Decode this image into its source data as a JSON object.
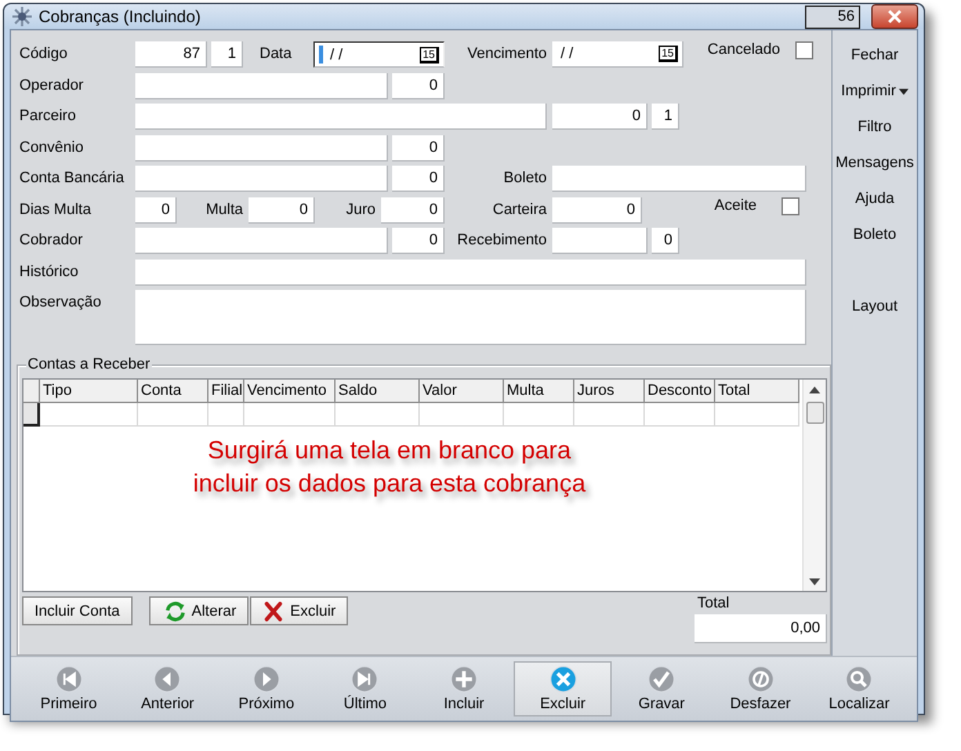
{
  "window": {
    "title": "Cobranças (Incluindo)",
    "counter": "56"
  },
  "form": {
    "codigo": {
      "label": "Código",
      "value": "87",
      "seq": "1"
    },
    "data": {
      "label": "Data",
      "value": "/ /",
      "calendar": "15",
      "focused": true
    },
    "vencimento": {
      "label": "Vencimento",
      "value": "/ /",
      "calendar": "15",
      "focused": false
    },
    "cancelado": {
      "label": "Cancelado",
      "checked": false
    },
    "operador": {
      "label": "Operador",
      "value": "0"
    },
    "parceiro": {
      "label": "Parceiro",
      "value": "0",
      "seq": "1"
    },
    "convenio": {
      "label": "Convênio",
      "value": "0"
    },
    "conta_bancaria": {
      "label": "Conta Bancária",
      "value": "0"
    },
    "boleto": {
      "label": "Boleto"
    },
    "dias_multa": {
      "label": "Dias Multa",
      "value": "0"
    },
    "multa": {
      "label": "Multa",
      "value": "0"
    },
    "juro": {
      "label": "Juro",
      "value": "0"
    },
    "carteira": {
      "label": "Carteira",
      "value": "0"
    },
    "aceite": {
      "label": "Aceite",
      "checked": false
    },
    "cobrador": {
      "label": "Cobrador",
      "value": "0"
    },
    "recebimento": {
      "label": "Recebimento",
      "value": "0"
    },
    "historico": {
      "label": "Histórico"
    },
    "observacao": {
      "label": "Observação"
    }
  },
  "sidebar": [
    {
      "label": "Fechar",
      "dropdown": false
    },
    {
      "label": "Imprimir",
      "dropdown": true
    },
    {
      "label": "Filtro",
      "dropdown": false
    },
    {
      "label": "Mensagens",
      "dropdown": false
    },
    {
      "label": "Ajuda",
      "dropdown": false
    },
    {
      "label": "Boleto",
      "dropdown": false
    },
    {
      "label": "Layout",
      "dropdown": false
    }
  ],
  "contas": {
    "title": "Contas a Receber",
    "columns": [
      "Tipo",
      "Conta",
      "Filial",
      "Vencimento",
      "Saldo",
      "Valor",
      "Multa",
      "Juros",
      "Desconto",
      "Total"
    ],
    "annotation": "Surgirá uma tela em branco para incluir os dados para esta cobrança",
    "buttons": [
      {
        "label": "Incluir Conta",
        "kind": "plain"
      },
      {
        "label": "Alterar",
        "kind": "refresh"
      },
      {
        "label": "Excluir",
        "kind": "delete"
      }
    ],
    "total_label": "Total",
    "total": "0,00"
  },
  "toolbar": [
    {
      "label": "Primeiro",
      "kind": "first",
      "selected": false
    },
    {
      "label": "Anterior",
      "kind": "prev",
      "selected": false
    },
    {
      "label": "Próximo",
      "kind": "next",
      "selected": false
    },
    {
      "label": "Último",
      "kind": "last",
      "selected": false
    },
    {
      "label": "Incluir",
      "kind": "add",
      "selected": false
    },
    {
      "label": "Excluir",
      "kind": "delete",
      "selected": true
    },
    {
      "label": "Gravar",
      "kind": "save",
      "selected": false
    },
    {
      "label": "Desfazer",
      "kind": "undo",
      "selected": false
    },
    {
      "label": "Localizar",
      "kind": "search",
      "selected": false
    }
  ]
}
